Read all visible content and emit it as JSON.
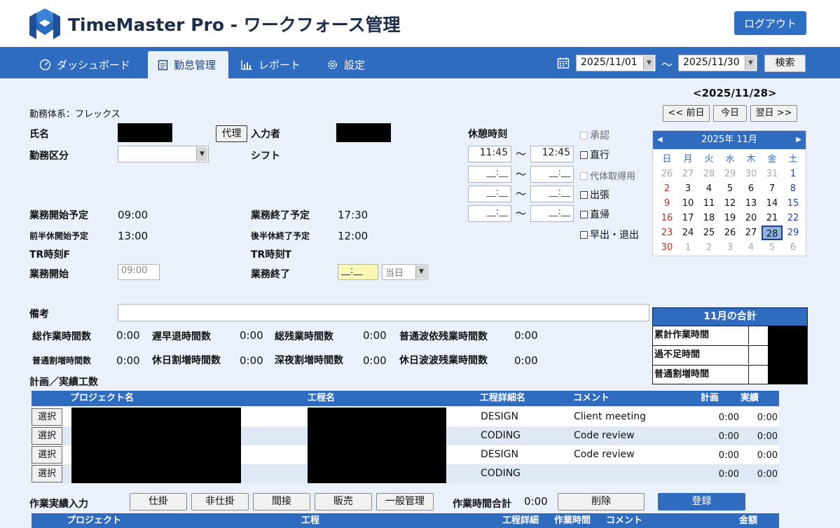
{
  "app": {
    "title": "TimeMaster Pro - ワークフォース管理",
    "logout": "ログアウト"
  },
  "nav": {
    "tabs": [
      {
        "label": "ダッシュボード",
        "icon": "gauge-icon"
      },
      {
        "label": "勤怠管理",
        "icon": "clipboard-icon"
      },
      {
        "label": "レポート",
        "icon": "bar-chart-icon"
      },
      {
        "label": "設定",
        "icon": "gear-icon"
      }
    ],
    "date_from": "2025/11/01",
    "tilde": "～",
    "date_to": "2025/11/30",
    "search": "検索"
  },
  "daynav": {
    "current": "<2025/11/28>",
    "prev": "<< 前日",
    "today": "今日",
    "next": "翌日 >>"
  },
  "form": {
    "work_system": "勤務体系：フレックス",
    "name_label": "氏名",
    "proxy_button": "代理",
    "inputter_label": "入力者",
    "work_class_label": "勤務区分",
    "shift_label": "シフト",
    "break_label": "休憩時刻",
    "breaks": [
      {
        "from": "11:45",
        "to": "12:45"
      },
      {
        "from": "__:__",
        "to": "__:__"
      },
      {
        "from": "__:__",
        "to": "__:__"
      },
      {
        "from": "__:__",
        "to": "__:__"
      }
    ],
    "checks": [
      "承認",
      "直行",
      "代体取得用",
      "出張",
      "直帰",
      "早出・退出"
    ],
    "start_plan_label": "業務開始予定",
    "start_plan": "09:00",
    "end_plan_label": "業務終了予定",
    "end_plan": "17:30",
    "first_break_label": "前半休開始予定",
    "first_break": "13:00",
    "second_break_label": "後半休終了予定",
    "second_break": "12:00",
    "tr_from_label": "TR時刻F",
    "tr_to_label": "TR時刻T",
    "start_label": "業務開始",
    "start_value": "09:00",
    "end_label": "業務終了",
    "end_value": "__:__",
    "end_day": "当日",
    "note_label": "備考"
  },
  "calendar": {
    "month": "2025年 11月",
    "weekdays": [
      "日",
      "月",
      "火",
      "水",
      "木",
      "金",
      "土"
    ],
    "weeks": [
      [
        "26",
        "27",
        "28",
        "29",
        "30",
        "31",
        "1"
      ],
      [
        "2",
        "3",
        "4",
        "5",
        "6",
        "7",
        "8"
      ],
      [
        "9",
        "10",
        "11",
        "12",
        "13",
        "14",
        "15"
      ],
      [
        "16",
        "17",
        "18",
        "19",
        "20",
        "21",
        "22"
      ],
      [
        "23",
        "24",
        "25",
        "26",
        "27",
        "28",
        "29"
      ],
      [
        "30",
        "1",
        "2",
        "3",
        "4",
        "5",
        "6"
      ]
    ],
    "selected": "28"
  },
  "stats": [
    {
      "label": "総作業時間数",
      "value": "0:00"
    },
    {
      "label": "遅早退時間数",
      "value": "0:00"
    },
    {
      "label": "総残業時間数",
      "value": "0:00"
    },
    {
      "label": "普通波依残業時間数",
      "value": "0:00"
    },
    {
      "label": "普通割増時間数",
      "value": "0:00"
    },
    {
      "label": "休日割増時間数",
      "value": "0:00"
    },
    {
      "label": "深夜割増時間数",
      "value": "0:00"
    },
    {
      "label": "休日波波残業時間数",
      "value": "0:00"
    }
  ],
  "monthly": {
    "title": "11月の合計",
    "rows": [
      "累計作業時間",
      "過不足時間",
      "普通割増時間"
    ]
  },
  "plan": {
    "title": "計画／実績工数",
    "headers": [
      "プロジェクト名",
      "工程名",
      "工程詳細名",
      "コメント",
      "計画",
      "実績"
    ],
    "select_label": "選択",
    "rows": [
      {
        "detail": "DESIGN",
        "comment": "Client meeting",
        "plan": "0:00",
        "actual": "0:00"
      },
      {
        "detail": "CODING",
        "comment": "Code review",
        "plan": "0:00",
        "actual": "0:00"
      },
      {
        "detail": "DESIGN",
        "comment": "Code review",
        "plan": "0:00",
        "actual": "0:00"
      },
      {
        "detail": "CODING",
        "comment": "",
        "plan": "0:00",
        "actual": "0:00"
      }
    ]
  },
  "actual": {
    "title": "作業実績入力",
    "buttons": [
      "仕掛",
      "非仕掛",
      "間接",
      "販売",
      "一般管理"
    ],
    "total_label": "作業時間合計",
    "total_value": "0:00",
    "delete": "削除",
    "register": "登録",
    "headers": [
      "プロジェクト",
      "工程",
      "工程詳細",
      "作業時間",
      "コメント",
      "金額"
    ]
  },
  "colors": {
    "primary": "#2f6cc0",
    "background": "#eaf1fb",
    "sunday": "#c62828",
    "saturday": "#1e3fc4"
  }
}
